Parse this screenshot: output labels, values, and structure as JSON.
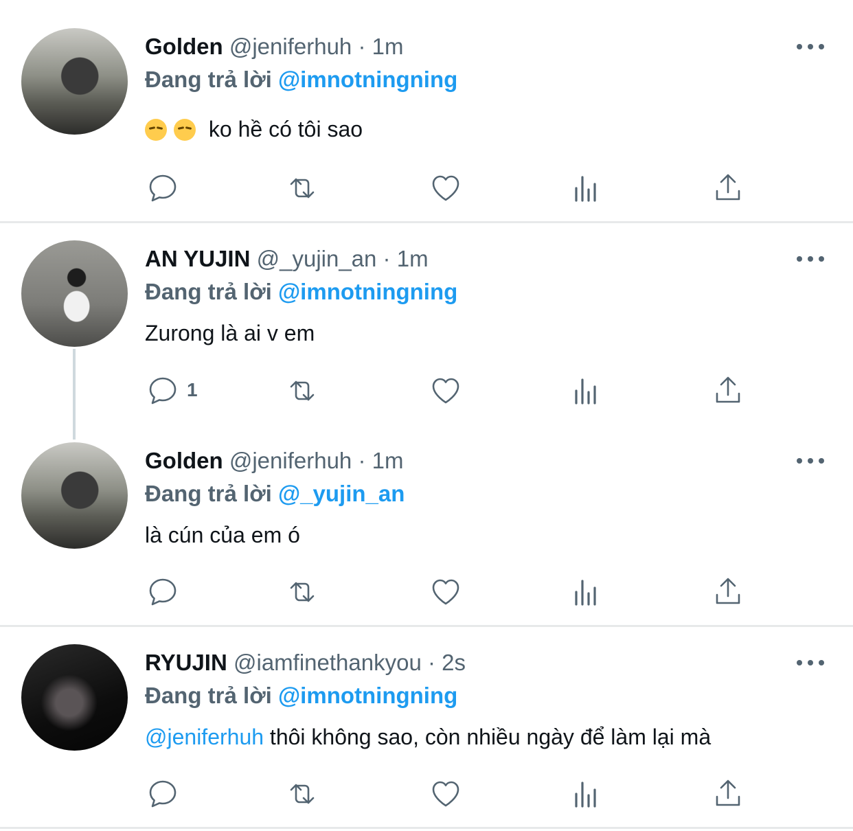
{
  "tweets": [
    {
      "name": "Golden",
      "handle": "@jeniferhuh",
      "sep": " · ",
      "time": "1m",
      "reply_prefix": "Đang trả lời ",
      "reply_to": "@imnotningning",
      "text": "ko hề có tôi sao",
      "emoji_names": [
        "pensive-face",
        "pensive-face"
      ],
      "reply_count": ""
    },
    {
      "name": "AN YUJIN",
      "handle": "@_yujin_an",
      "sep": " · ",
      "time": "1m",
      "reply_prefix": "Đang trả lời ",
      "reply_to": "@imnotningning",
      "text": "Zurong là ai v em",
      "reply_count": "1"
    },
    {
      "name": "Golden",
      "handle": "@jeniferhuh",
      "sep": " · ",
      "time": "1m",
      "reply_prefix": "Đang trả lời ",
      "reply_to": "@_yujin_an",
      "text": "là cún của em ó",
      "reply_count": ""
    },
    {
      "name": "RYUJIN",
      "handle": "@iamfinethankyou",
      "sep": " · ",
      "time": "2s",
      "reply_prefix": "Đang trả lời ",
      "reply_to": "@imnotningning",
      "text_mention": "@jeniferhuh",
      "text": " thôi không sao, còn nhiều ngày để làm lại mà",
      "reply_count": ""
    }
  ],
  "icons": [
    "reply-icon",
    "retweet-icon",
    "like-icon",
    "views-icon",
    "share-icon",
    "more-icon"
  ],
  "colors": {
    "link": "#1d9bf0",
    "muted": "#536471",
    "text": "#0f1419",
    "divider": "#e7e9ea"
  }
}
